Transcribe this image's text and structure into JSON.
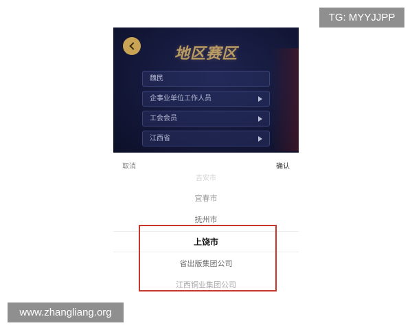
{
  "watermarks": {
    "top_right": "TG: MYYJJPP",
    "bottom_left": "www.zhangliang.org"
  },
  "page": {
    "title": "地区赛区",
    "back_icon": "back-arrow-icon",
    "fields": [
      {
        "label": "魏民",
        "has_arrow": false
      },
      {
        "label": "企事业单位工作人员",
        "has_arrow": true
      },
      {
        "label": "工会会员",
        "has_arrow": true
      },
      {
        "label": "江西省",
        "has_arrow": true
      }
    ]
  },
  "picker": {
    "cancel_label": "取消",
    "confirm_label": "确认",
    "items": [
      "吉安市",
      "宜春市",
      "抚州市",
      "上饶市",
      "省出版集团公司",
      "江西铜业集团公司",
      ""
    ],
    "selected_index": 3
  },
  "colors": {
    "highlight_border": "#c8352a",
    "top_background": "#14183a",
    "title_gold": "#b89a62"
  }
}
